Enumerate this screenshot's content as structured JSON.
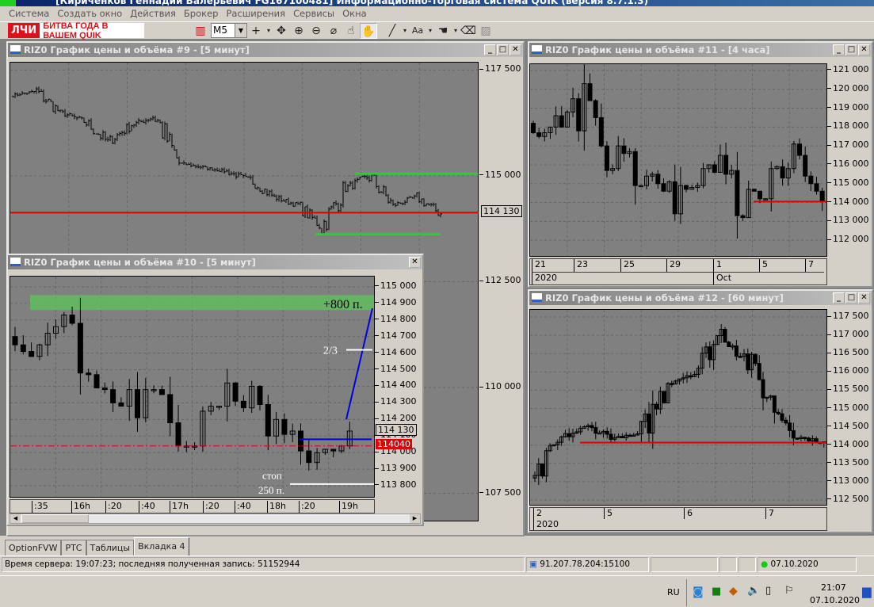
{
  "app": {
    "title": "[Кириченков Геннадий Валерьевич FG167100481] Информационно-торговая система QUIK (версия 8.7.1.3)"
  },
  "menu": [
    "Система",
    "Создать окно",
    "Действия",
    "Брокер",
    "Расширения",
    "Сервисы",
    "Окна"
  ],
  "toolbar": {
    "banner_logo": "ЛЧИ",
    "banner_text": "БИТВА ГОДА В ВАШЕМ QUIK",
    "interval": "M5",
    "icons": [
      "chart-icon",
      "crosshair-icon",
      "move-icon",
      "zoom-in-icon",
      "zoom-out-icon",
      "ruler-icon",
      "finger-icon",
      "hand-icon",
      "line-icon",
      "text-icon",
      "pointer-icon",
      "erase-icon"
    ]
  },
  "colors": {
    "bg": "#808080",
    "red": "#e00000",
    "green": "#40c040",
    "blue": "#0000e0",
    "white": "#ffffff"
  },
  "windows": {
    "w9": {
      "title": "RIZ0 График цены и объёма #9 - [5 минут]",
      "yticks": [
        "117 500",
        "115 000",
        "112 500",
        "110 000",
        "107 500"
      ],
      "ytick_values": [
        117500,
        115000,
        112500,
        110000,
        107500
      ],
      "ylim": [
        106855,
        117676
      ],
      "price_label": "114 130",
      "price_line": 114130,
      "green_lines": [
        115050,
        113620
      ],
      "time_fragment": "h",
      "path": [
        116900,
        117000,
        116500,
        116300,
        115800,
        116200,
        116400,
        115300,
        115200,
        115100,
        114900,
        114500,
        114300,
        113800,
        114700,
        115000,
        114300,
        114500,
        114100
      ]
    },
    "w10": {
      "title": "RIZ0 График цены и объёма #10 - [5 минут]",
      "yticks": [
        "115 000",
        "114 900",
        "114 800",
        "114 700",
        "114 600",
        "114 500",
        "114 400",
        "114 300",
        "114 200",
        "114 100",
        "114 000",
        "113 900",
        "113 800"
      ],
      "ytick_values": [
        115000,
        114900,
        114800,
        114700,
        114600,
        114500,
        114400,
        114300,
        114200,
        114100,
        114000,
        113900,
        113800
      ],
      "ylim": [
        113733,
        115062
      ],
      "price_label": "114 130",
      "red_label": "114040",
      "red_line": 114040,
      "target_zone": [
        114860,
        114950
      ],
      "target_text": "+800 п.",
      "two_thirds_text": "2/3",
      "two_thirds_level": 114620,
      "stop_text_1": "стоп",
      "stop_text_2": "250 п.",
      "stop_level": 113810,
      "entry_level": 114080,
      "xticks": [
        ":35",
        "16h",
        ":20",
        ":40",
        "17h",
        ":20",
        ":40",
        "18h",
        ":20",
        "19h"
      ],
      "closes": [
        114650,
        114610,
        114580,
        114650,
        114720,
        114760,
        114830,
        114780,
        114480,
        114470,
        114390,
        114380,
        114300,
        114280,
        114380,
        114210,
        114380,
        114380,
        114350,
        114180,
        114040,
        114040,
        114040,
        114250,
        114280,
        114280,
        114420,
        114310,
        114270,
        114400,
        114290,
        114100,
        114200,
        114110,
        114130,
        114010,
        113940,
        114000,
        114020,
        114010,
        114040,
        114130
      ]
    },
    "w11": {
      "title": "RIZ0 График цены и объёма #11 - [4 часа]",
      "yticks": [
        "121 000",
        "120 000",
        "119 000",
        "118 000",
        "117 000",
        "116 000",
        "115 000",
        "114 000",
        "113 000",
        "112 000"
      ],
      "ytick_values": [
        121000,
        120000,
        119000,
        118000,
        117000,
        116000,
        115000,
        114000,
        113000,
        112000
      ],
      "ylim": [
        111167,
        121333
      ],
      "red_line": 114050,
      "xticks": [
        "21",
        "23",
        "25",
        "29",
        "1",
        "5",
        "7"
      ],
      "xticks2": [
        "2020",
        "Oct"
      ],
      "closes": [
        117700,
        117500,
        117700,
        118000,
        118600,
        118000,
        118800,
        119500,
        117800,
        120300,
        119400,
        118500,
        117000,
        115700,
        115800,
        117000,
        116600,
        116700,
        114900,
        114900,
        115400,
        115500,
        115000,
        114600,
        115100,
        113400,
        114900,
        114700,
        114800,
        114900,
        115800,
        116000,
        115600,
        116500,
        115500,
        115700,
        113300,
        113200,
        114700,
        114600,
        114200,
        114200,
        115800,
        115900,
        115300,
        115800,
        117100,
        116500,
        115400,
        115000,
        114600,
        114050
      ]
    },
    "w12": {
      "title": "RIZ0 График цены и объёма #12 - [60 минут]",
      "yticks": [
        "117 500",
        "117 000",
        "116 500",
        "116 000",
        "115 500",
        "115 000",
        "114 500",
        "114 000",
        "113 500",
        "113 000",
        "112 500"
      ],
      "ytick_values": [
        117500,
        117000,
        116500,
        116000,
        115500,
        115000,
        114500,
        114000,
        113500,
        113000,
        112500
      ],
      "ylim": [
        112370,
        117695
      ],
      "red_line": 114070,
      "xticks": [
        "2",
        "5",
        "6",
        "7"
      ],
      "xticks2": [
        "2020"
      ],
      "path": [
        113000,
        114200,
        114500,
        114200,
        114300,
        115700,
        116000,
        117100,
        116300,
        115000,
        114200,
        114050
      ]
    }
  },
  "tabs": [
    "OptionFVW",
    "РТС",
    "Таблицы",
    "Вкладка 4"
  ],
  "status": {
    "server": "Время сервера: 19:07:23; последняя полученная запись: 51152944",
    "address": "91.207.78.204:15100",
    "date": "07.10.2020"
  },
  "taskbar": {
    "lang": "RU",
    "time": "21:07",
    "date": "07.10.2020"
  }
}
